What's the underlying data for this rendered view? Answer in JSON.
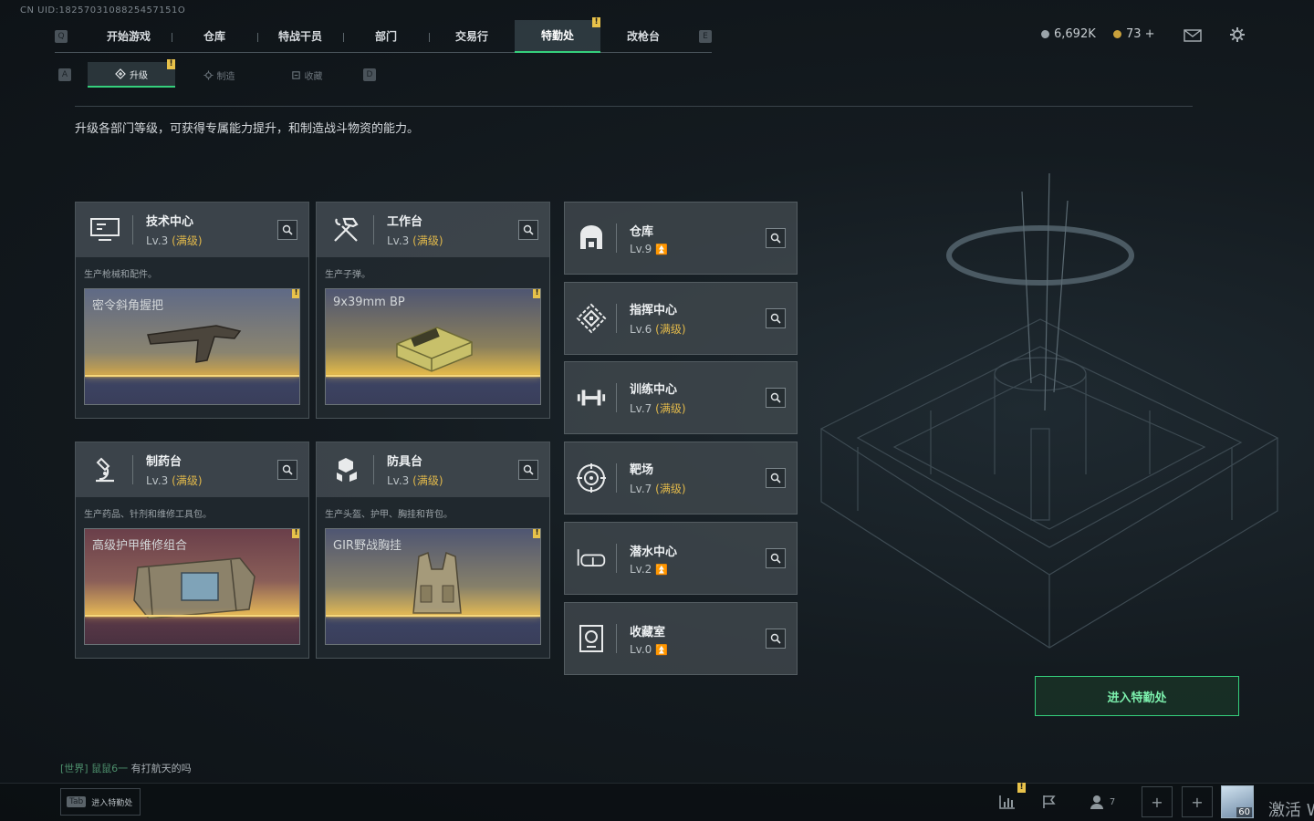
{
  "uid": "CN UID:1825703108825457151O",
  "nav": {
    "left_key": "Q",
    "right_key": "E",
    "tabs": [
      "开始游戏",
      "仓库",
      "特战干员",
      "部门",
      "交易行",
      "特勤处",
      "改枪台"
    ],
    "active": "特勤处",
    "badge": "!"
  },
  "subnav": {
    "left_key": "A",
    "right_key": "D",
    "tabs": [
      "升级",
      "制造",
      "收藏"
    ],
    "active": "升级",
    "badge": "!"
  },
  "currency": {
    "silver": "6,692K",
    "gold": "73 +",
    "silver_color": "#9aa3a9",
    "gold_color": "#c9a13c"
  },
  "intro": "升级各部门等级，可获得专属能力提升，和制造战斗物资的能力。",
  "level_prefix": "Lv.",
  "max_label": "(满级)",
  "production_cards": [
    {
      "name": "技术中心",
      "level": "3",
      "desc": "生产枪械和配件。",
      "product": "密令斜角握把",
      "icon": "computer-icon"
    },
    {
      "name": "工作台",
      "level": "3",
      "desc": "生产子弹。",
      "product": "9x39mm BP",
      "icon": "hammer-wrench-icon"
    },
    {
      "name": "制药台",
      "level": "3",
      "desc": "生产药品、针剂和维修工具包。",
      "product": "高级护甲维修组合",
      "icon": "microscope-icon"
    },
    {
      "name": "防具台",
      "level": "3",
      "desc": "生产头盔、护甲、胸挂和背包。",
      "product": "GIR野战胸挂",
      "icon": "armor-blocks-icon"
    }
  ],
  "building_cards": [
    {
      "name": "仓库",
      "level": "9",
      "max": false,
      "icon": "warehouse-icon"
    },
    {
      "name": "指挥中心",
      "level": "6",
      "max": true,
      "icon": "command-icon"
    },
    {
      "name": "训练中心",
      "level": "7",
      "max": true,
      "icon": "dumbbell-icon"
    },
    {
      "name": "靶场",
      "level": "7",
      "max": true,
      "icon": "target-icon"
    },
    {
      "name": "潜水中心",
      "level": "2",
      "max": false,
      "icon": "diving-mask-icon"
    },
    {
      "name": "收藏室",
      "level": "0",
      "max": false,
      "icon": "trophy-icon"
    }
  ],
  "enter_button": "进入特勤处",
  "chat": {
    "channel": "[世界]",
    "nick": "鼠鼠6一",
    "message": "有打航天的吗"
  },
  "tab_hint": {
    "key": "Tab",
    "label": "进入特勤处"
  },
  "bottom": {
    "friends_count": "7",
    "player_level": "60",
    "activate": "激活 W"
  }
}
